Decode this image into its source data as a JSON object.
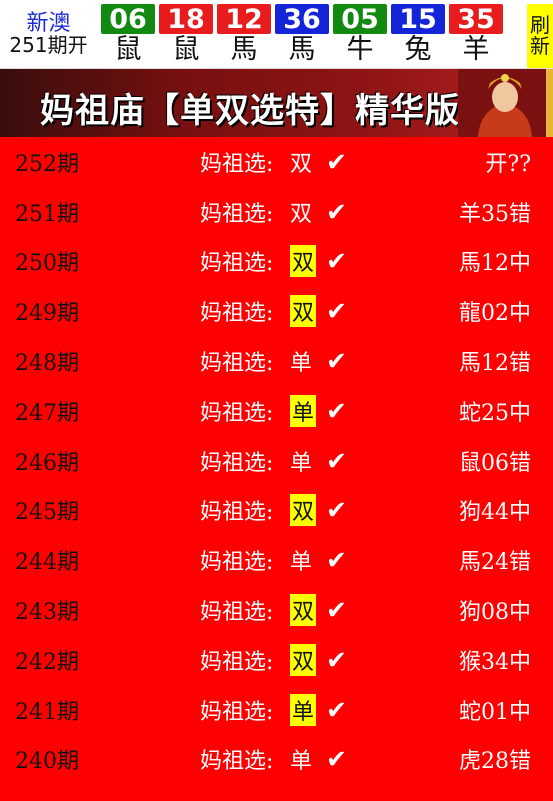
{
  "header": {
    "region": "新澳",
    "period": "251期开",
    "balls": [
      {
        "num": "06",
        "zodiac": "鼠",
        "color": "#128a12"
      },
      {
        "num": "18",
        "zodiac": "鼠",
        "color": "#e81c1c"
      },
      {
        "num": "12",
        "zodiac": "馬",
        "color": "#e81c1c"
      },
      {
        "num": "36",
        "zodiac": "馬",
        "color": "#1424d8"
      },
      {
        "num": "05",
        "zodiac": "牛",
        "color": "#128a12"
      },
      {
        "num": "15",
        "zodiac": "兔",
        "color": "#1424d8"
      },
      {
        "num": "35",
        "zodiac": "羊",
        "color": "#e81c1c"
      }
    ],
    "refresh_label": [
      "刷",
      "新"
    ]
  },
  "banner": {
    "title": "妈祖庙【单双选特】精华版"
  },
  "rows": [
    {
      "period": "252期",
      "label": "妈祖选:",
      "pick": "双",
      "highlight": false,
      "check": "✔",
      "result": "开??"
    },
    {
      "period": "251期",
      "label": "妈祖选:",
      "pick": "双",
      "highlight": false,
      "check": "✔",
      "result": "羊35错"
    },
    {
      "period": "250期",
      "label": "妈祖选:",
      "pick": "双",
      "highlight": true,
      "check": "✔",
      "result": "馬12中"
    },
    {
      "period": "249期",
      "label": "妈祖选:",
      "pick": "双",
      "highlight": true,
      "check": "✔",
      "result": "龍02中"
    },
    {
      "period": "248期",
      "label": "妈祖选:",
      "pick": "单",
      "highlight": false,
      "check": "✔",
      "result": "馬12错"
    },
    {
      "period": "247期",
      "label": "妈祖选:",
      "pick": "单",
      "highlight": true,
      "check": "✔",
      "result": "蛇25中"
    },
    {
      "period": "246期",
      "label": "妈祖选:",
      "pick": "单",
      "highlight": false,
      "check": "✔",
      "result": "鼠06错"
    },
    {
      "period": "245期",
      "label": "妈祖选:",
      "pick": "双",
      "highlight": true,
      "check": "✔",
      "result": "狗44中"
    },
    {
      "period": "244期",
      "label": "妈祖选:",
      "pick": "单",
      "highlight": false,
      "check": "✔",
      "result": "馬24错"
    },
    {
      "period": "243期",
      "label": "妈祖选:",
      "pick": "双",
      "highlight": true,
      "check": "✔",
      "result": "狗08中"
    },
    {
      "period": "242期",
      "label": "妈祖选:",
      "pick": "双",
      "highlight": true,
      "check": "✔",
      "result": "猴34中"
    },
    {
      "period": "241期",
      "label": "妈祖选:",
      "pick": "单",
      "highlight": true,
      "check": "✔",
      "result": "蛇01中"
    },
    {
      "period": "240期",
      "label": "妈祖选:",
      "pick": "单",
      "highlight": false,
      "check": "✔",
      "result": "虎28错"
    }
  ]
}
